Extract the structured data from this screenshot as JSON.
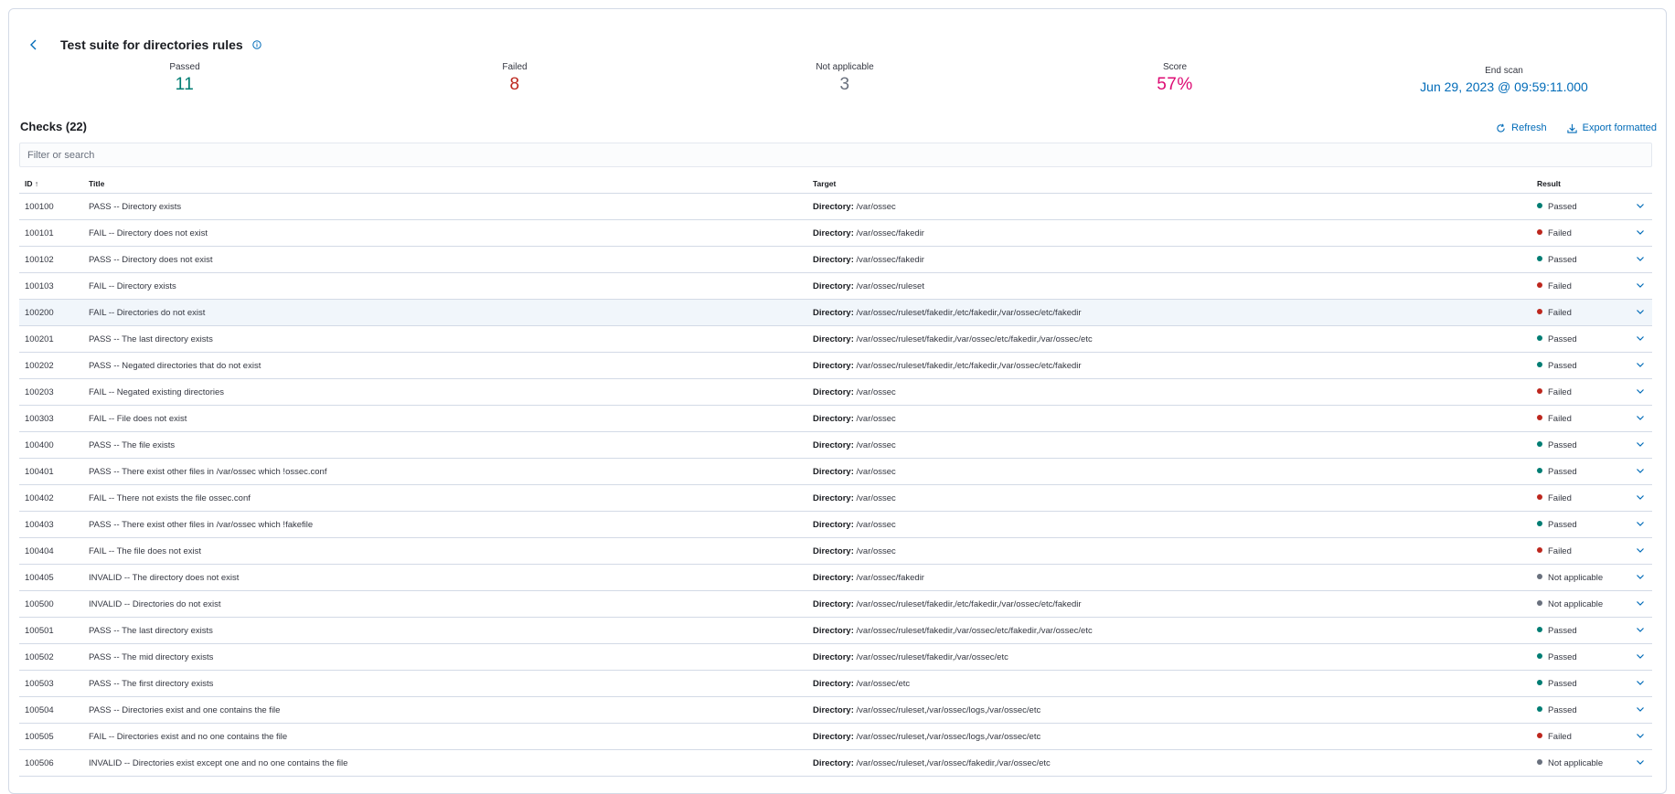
{
  "header": {
    "title": "Test suite for directories rules"
  },
  "stats": [
    {
      "label": "Passed",
      "value": "11",
      "color": "#017d73"
    },
    {
      "label": "Failed",
      "value": "8",
      "color": "#bd271e"
    },
    {
      "label": "Not applicable",
      "value": "3",
      "color": "#69707d"
    },
    {
      "label": "Score",
      "value": "57%",
      "color": "#dd0a73"
    },
    {
      "label": "End scan",
      "value": "Jun 29, 2023 @ 09:59:11.000",
      "color": "#006bb8"
    }
  ],
  "checks": {
    "title": "Checks (22)",
    "refresh_label": "Refresh",
    "export_label": "Export formatted",
    "search_placeholder": "Filter or search"
  },
  "table": {
    "columns": {
      "id": "ID",
      "title": "Title",
      "target": "Target",
      "result": "Result"
    },
    "target_label": "Directory:",
    "rows": [
      {
        "id": "100100",
        "title": "PASS -- Directory exists",
        "target": "/var/ossec",
        "result": "Passed"
      },
      {
        "id": "100101",
        "title": "FAIL -- Directory does not exist",
        "target": "/var/ossec/fakedir",
        "result": "Failed"
      },
      {
        "id": "100102",
        "title": "PASS -- Directory does not exist",
        "target": "/var/ossec/fakedir",
        "result": "Passed"
      },
      {
        "id": "100103",
        "title": "FAIL -- Directory exists",
        "target": "/var/ossec/ruleset",
        "result": "Failed"
      },
      {
        "id": "100200",
        "title": "FAIL -- Directories do not exist",
        "target": "/var/ossec/ruleset/fakedir,/etc/fakedir,/var/ossec/etc/fakedir",
        "result": "Failed"
      },
      {
        "id": "100201",
        "title": "PASS -- The last directory exists",
        "target": "/var/ossec/ruleset/fakedir,/var/ossec/etc/fakedir,/var/ossec/etc",
        "result": "Passed"
      },
      {
        "id": "100202",
        "title": "PASS -- Negated directories that do not exist",
        "target": "/var/ossec/ruleset/fakedir,/etc/fakedir,/var/ossec/etc/fakedir",
        "result": "Passed"
      },
      {
        "id": "100203",
        "title": "FAIL -- Negated existing directories",
        "target": "/var/ossec",
        "result": "Failed"
      },
      {
        "id": "100303",
        "title": "FAIL -- File does not exist",
        "target": "/var/ossec",
        "result": "Failed"
      },
      {
        "id": "100400",
        "title": "PASS -- The file exists",
        "target": "/var/ossec",
        "result": "Passed"
      },
      {
        "id": "100401",
        "title": "PASS -- There exist other files in /var/ossec which !ossec.conf",
        "target": "/var/ossec",
        "result": "Passed"
      },
      {
        "id": "100402",
        "title": "FAIL -- There not exists the file ossec.conf",
        "target": "/var/ossec",
        "result": "Failed"
      },
      {
        "id": "100403",
        "title": "PASS -- There exist other files in /var/ossec which !fakefile",
        "target": "/var/ossec",
        "result": "Passed"
      },
      {
        "id": "100404",
        "title": "FAIL -- The file does not exist",
        "target": "/var/ossec",
        "result": "Failed"
      },
      {
        "id": "100405",
        "title": "INVALID -- The directory does not exist",
        "target": "/var/ossec/fakedir",
        "result": "Not applicable"
      },
      {
        "id": "100500",
        "title": "INVALID -- Directories do not exist",
        "target": "/var/ossec/ruleset/fakedir,/etc/fakedir,/var/ossec/etc/fakedir",
        "result": "Not applicable"
      },
      {
        "id": "100501",
        "title": "PASS -- The last directory exists",
        "target": "/var/ossec/ruleset/fakedir,/var/ossec/etc/fakedir,/var/ossec/etc",
        "result": "Passed"
      },
      {
        "id": "100502",
        "title": "PASS -- The mid directory exists",
        "target": "/var/ossec/ruleset/fakedir,/var/ossec/etc",
        "result": "Passed"
      },
      {
        "id": "100503",
        "title": "PASS -- The first directory exists",
        "target": "/var/ossec/etc",
        "result": "Passed"
      },
      {
        "id": "100504",
        "title": "PASS -- Directories exist and one contains the file",
        "target": "/var/ossec/ruleset,/var/ossec/logs,/var/ossec/etc",
        "result": "Passed"
      },
      {
        "id": "100505",
        "title": "FAIL -- Directories exist and no one contains the file",
        "target": "/var/ossec/ruleset,/var/ossec/logs,/var/ossec/etc",
        "result": "Failed"
      },
      {
        "id": "100506",
        "title": "INVALID -- Directories exist except one and no one contains the file",
        "target": "/var/ossec/ruleset,/var/ossec/fakedir,/var/ossec/etc",
        "result": "Not applicable"
      }
    ]
  },
  "colors": {
    "accent": "#006bb8",
    "passed": "#017d73",
    "failed": "#bd271e",
    "not_applicable": "#69707d"
  }
}
